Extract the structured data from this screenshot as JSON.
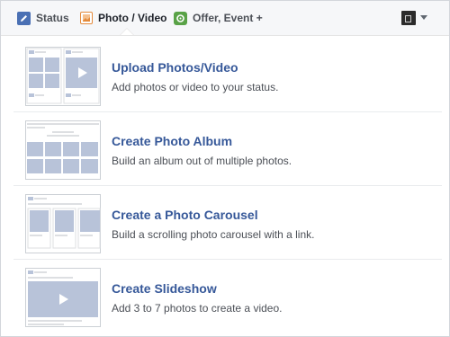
{
  "tabs": [
    {
      "label": "Status",
      "icon": "pencil-icon"
    },
    {
      "label": "Photo / Video",
      "icon": "photo-icon",
      "selected": true
    },
    {
      "label": "Offer, Event +",
      "icon": "offer-icon"
    }
  ],
  "options": [
    {
      "title": "Upload Photos/Video",
      "desc": "Add photos or video to your status.",
      "icon": "upload-thumbnail"
    },
    {
      "title": "Create Photo Album",
      "desc": "Build an album out of multiple photos.",
      "icon": "album-thumbnail"
    },
    {
      "title": "Create a Photo Carousel",
      "desc": "Build a scrolling photo carousel with a link.",
      "icon": "carousel-thumbnail"
    },
    {
      "title": "Create Slideshow",
      "desc": "Add 3 to 7 photos to create a video.",
      "icon": "slideshow-thumbnail"
    }
  ],
  "colors": {
    "link": "#365899",
    "text": "#4b4f56",
    "thumb": "#b8c3d9"
  }
}
